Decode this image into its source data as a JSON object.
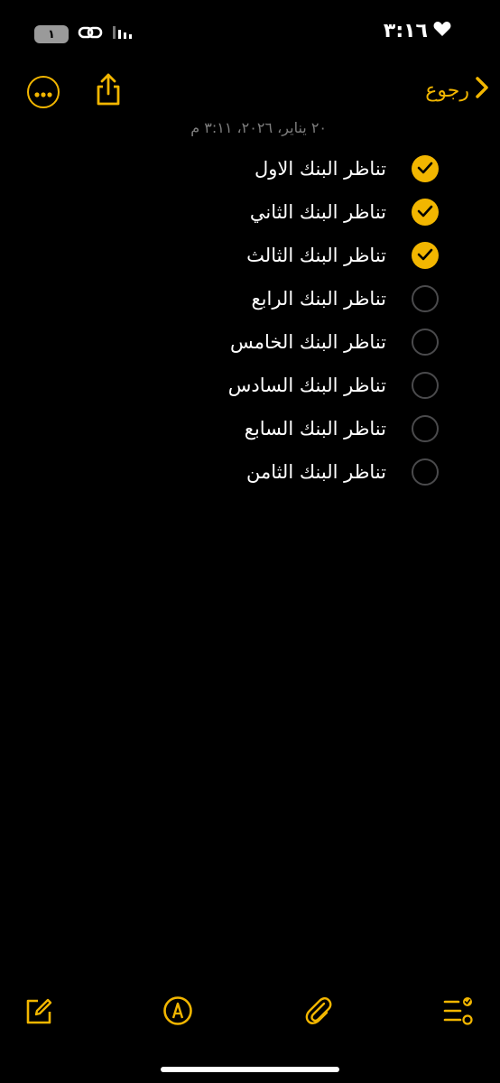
{
  "status_bar": {
    "time": "٣:١٦",
    "battery": "١"
  },
  "nav": {
    "back_label": "رجوع",
    "more_icon": "ellipsis-circle-icon",
    "share_icon": "share-icon"
  },
  "note": {
    "date": "٢٠ يناير، ٢٠٢٦، ٣:١١ م",
    "items": [
      {
        "label": "تناظر البنك الاول",
        "checked": true
      },
      {
        "label": "تناظر البنك الثاني",
        "checked": true
      },
      {
        "label": "تناظر البنك الثالث",
        "checked": true
      },
      {
        "label": "تناظر البنك الرابع",
        "checked": false
      },
      {
        "label": "تناظر البنك الخامس",
        "checked": false
      },
      {
        "label": "تناظر البنك السادس",
        "checked": false
      },
      {
        "label": "تناظر البنك السابع",
        "checked": false
      },
      {
        "label": "تناظر البنك الثامن",
        "checked": false
      }
    ]
  },
  "toolbar": {
    "icons": [
      "compose-icon",
      "markup-icon",
      "paperclip-icon",
      "checklist-icon"
    ]
  },
  "colors": {
    "accent": "#f2b600",
    "background": "#000000",
    "secondary_text": "#7d7d7d"
  }
}
